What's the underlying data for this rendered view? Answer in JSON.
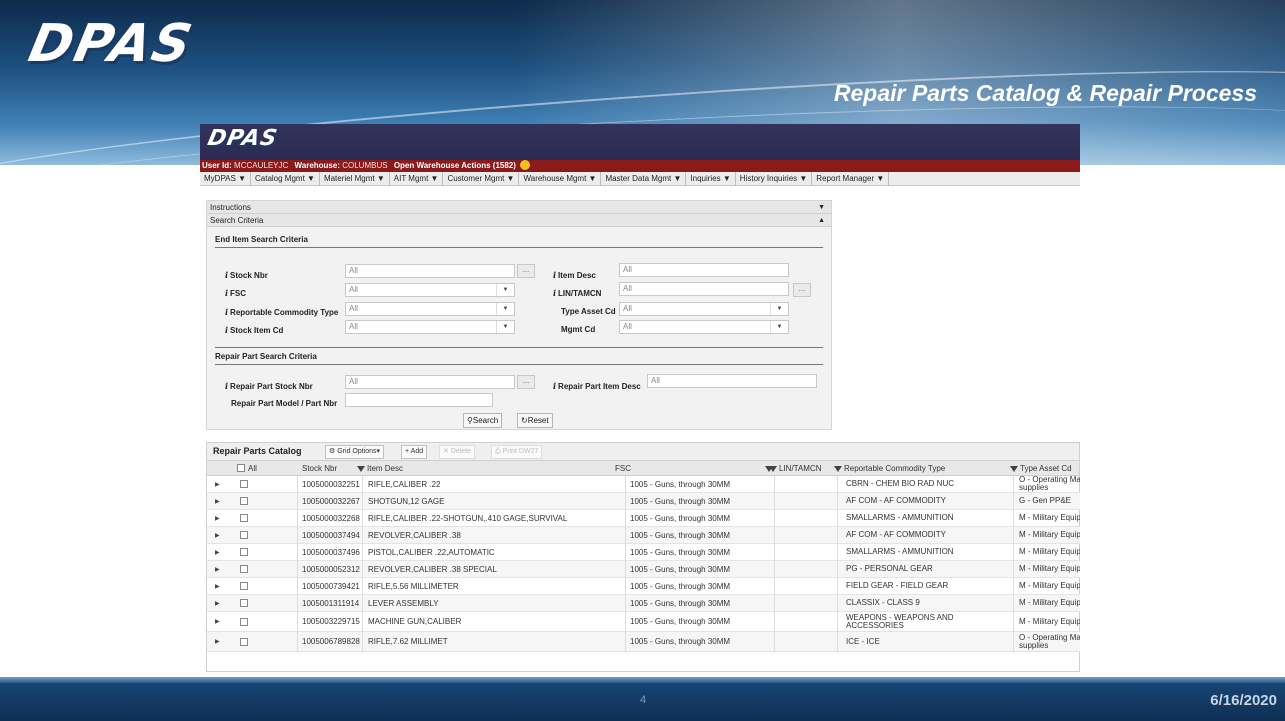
{
  "slide": {
    "logo": "DPAS",
    "title": "Repair Parts Catalog & Repair Process",
    "page_number": "4",
    "date": "6/16/2020"
  },
  "app": {
    "logo": "DPAS",
    "user_bar": {
      "user_label": "User Id:",
      "user_value": "MCCAULEYJC",
      "warehouse_label": "Warehouse:",
      "warehouse_value": "COLUMBUS",
      "open_actions": "Open Warehouse Actions (1582)"
    },
    "menu": [
      "MyDPAS ▼",
      "Catalog Mgmt ▼",
      "Materiel Mgmt ▼",
      "AIT Mgmt ▼",
      "Customer Mgmt ▼",
      "Warehouse Mgmt ▼",
      "Master Data Mgmt ▼",
      "Inquiries ▼",
      "History Inquiries ▼",
      "Report Manager ▼"
    ],
    "accordion": {
      "instructions": "Instructions",
      "search_criteria": "Search Criteria"
    },
    "end_item": {
      "title": "End Item Search Criteria",
      "stock_nbr_label": "Stock Nbr",
      "stock_nbr_value": "All",
      "fsc_label": "FSC",
      "fsc_value": "All",
      "rct_label": "Reportable Commodity Type",
      "rct_value": "All",
      "stock_item_cd_label": "Stock Item Cd",
      "stock_item_cd_value": "All",
      "item_desc_label": "Item Desc",
      "item_desc_value": "All",
      "lin_label": "LIN/TAMCN",
      "lin_value": "All",
      "type_asset_label": "Type Asset Cd",
      "type_asset_value": "All",
      "mgmt_cd_label": "Mgmt Cd",
      "mgmt_cd_value": "All"
    },
    "repair_part": {
      "title": "Repair Part Search Criteria",
      "stock_nbr_label": "Repair Part Stock Nbr",
      "stock_nbr_value": "All",
      "item_desc_label": "Repair Part Item Desc",
      "item_desc_value": "All",
      "model_label": "Repair Part Model / Part Nbr",
      "model_value": ""
    },
    "buttons": {
      "search": "Search",
      "reset": "Reset",
      "ellipsis": "..."
    },
    "grid": {
      "title": "Repair Parts Catalog",
      "grid_options": "Grid Options▾",
      "add": "Add",
      "delete": "Delete",
      "print": "Print DW27",
      "columns": {
        "all": "All",
        "stock_nbr": "Stock Nbr",
        "item_desc": "Item Desc",
        "fsc": "FSC",
        "lin": "LIN/TAMCN",
        "rct": "Reportable Commodity Type",
        "type_asset": "Type Asset Cd"
      },
      "rows": [
        {
          "stock_nbr": "1005000032251",
          "item_desc": "RIFLE,CALIBER .22",
          "fsc": "1005 - Guns, through 30MM",
          "lin": "",
          "rct": "CBRN - CHEM BIO RAD NUC",
          "type_asset": "O - Operating Ma supplies"
        },
        {
          "stock_nbr": "1005000032267",
          "item_desc": "SHOTGUN,12 GAGE",
          "fsc": "1005 - Guns, through 30MM",
          "lin": "",
          "rct": "AF COM - AF COMMODITY",
          "type_asset": "G - Gen PP&E"
        },
        {
          "stock_nbr": "1005000032268",
          "item_desc": "RIFLE,CALIBER .22-SHOTGUN,.410 GAGE,SURVIVAL",
          "fsc": "1005 - Guns, through 30MM",
          "lin": "",
          "rct": "SMALLARMS - AMMUNITION",
          "type_asset": "M - Military Equip"
        },
        {
          "stock_nbr": "1005000037494",
          "item_desc": "REVOLVER,CALIBER .38",
          "fsc": "1005 - Guns, through 30MM",
          "lin": "",
          "rct": "AF COM - AF COMMODITY",
          "type_asset": "M - Military Equip"
        },
        {
          "stock_nbr": "1005000037496",
          "item_desc": "PISTOL,CALIBER .22,AUTOMATIC",
          "fsc": "1005 - Guns, through 30MM",
          "lin": "",
          "rct": "SMALLARMS - AMMUNITION",
          "type_asset": "M - Military Equip"
        },
        {
          "stock_nbr": "1005000052312",
          "item_desc": "REVOLVER,CALIBER .38 SPECIAL",
          "fsc": "1005 - Guns, through 30MM",
          "lin": "",
          "rct": "PG - PERSONAL GEAR",
          "type_asset": "M - Military Equip"
        },
        {
          "stock_nbr": "1005000739421",
          "item_desc": "RIFLE,5.56 MILLIMETER",
          "fsc": "1005 - Guns, through 30MM",
          "lin": "",
          "rct": "FIELD GEAR - FIELD GEAR",
          "type_asset": "M - Military Equip"
        },
        {
          "stock_nbr": "1005001311914",
          "item_desc": "LEVER ASSEMBLY",
          "fsc": "1005 - Guns, through 30MM",
          "lin": "",
          "rct": "CLASSIX - CLASS 9",
          "type_asset": "M - Military Equip"
        },
        {
          "stock_nbr": "1005003229715",
          "item_desc": "MACHINE GUN,CALIBER",
          "fsc": "1005 - Guns, through 30MM",
          "lin": "",
          "rct": "WEAPONS - WEAPONS AND ACCESSORIES",
          "type_asset": "M - Military Equip"
        },
        {
          "stock_nbr": "1005006789828",
          "item_desc": "RIFLE,7.62 MILLIMET",
          "fsc": "1005 - Guns, through 30MM",
          "lin": "",
          "rct": "ICE - ICE",
          "type_asset": "O - Operating Ma supplies"
        }
      ]
    }
  }
}
